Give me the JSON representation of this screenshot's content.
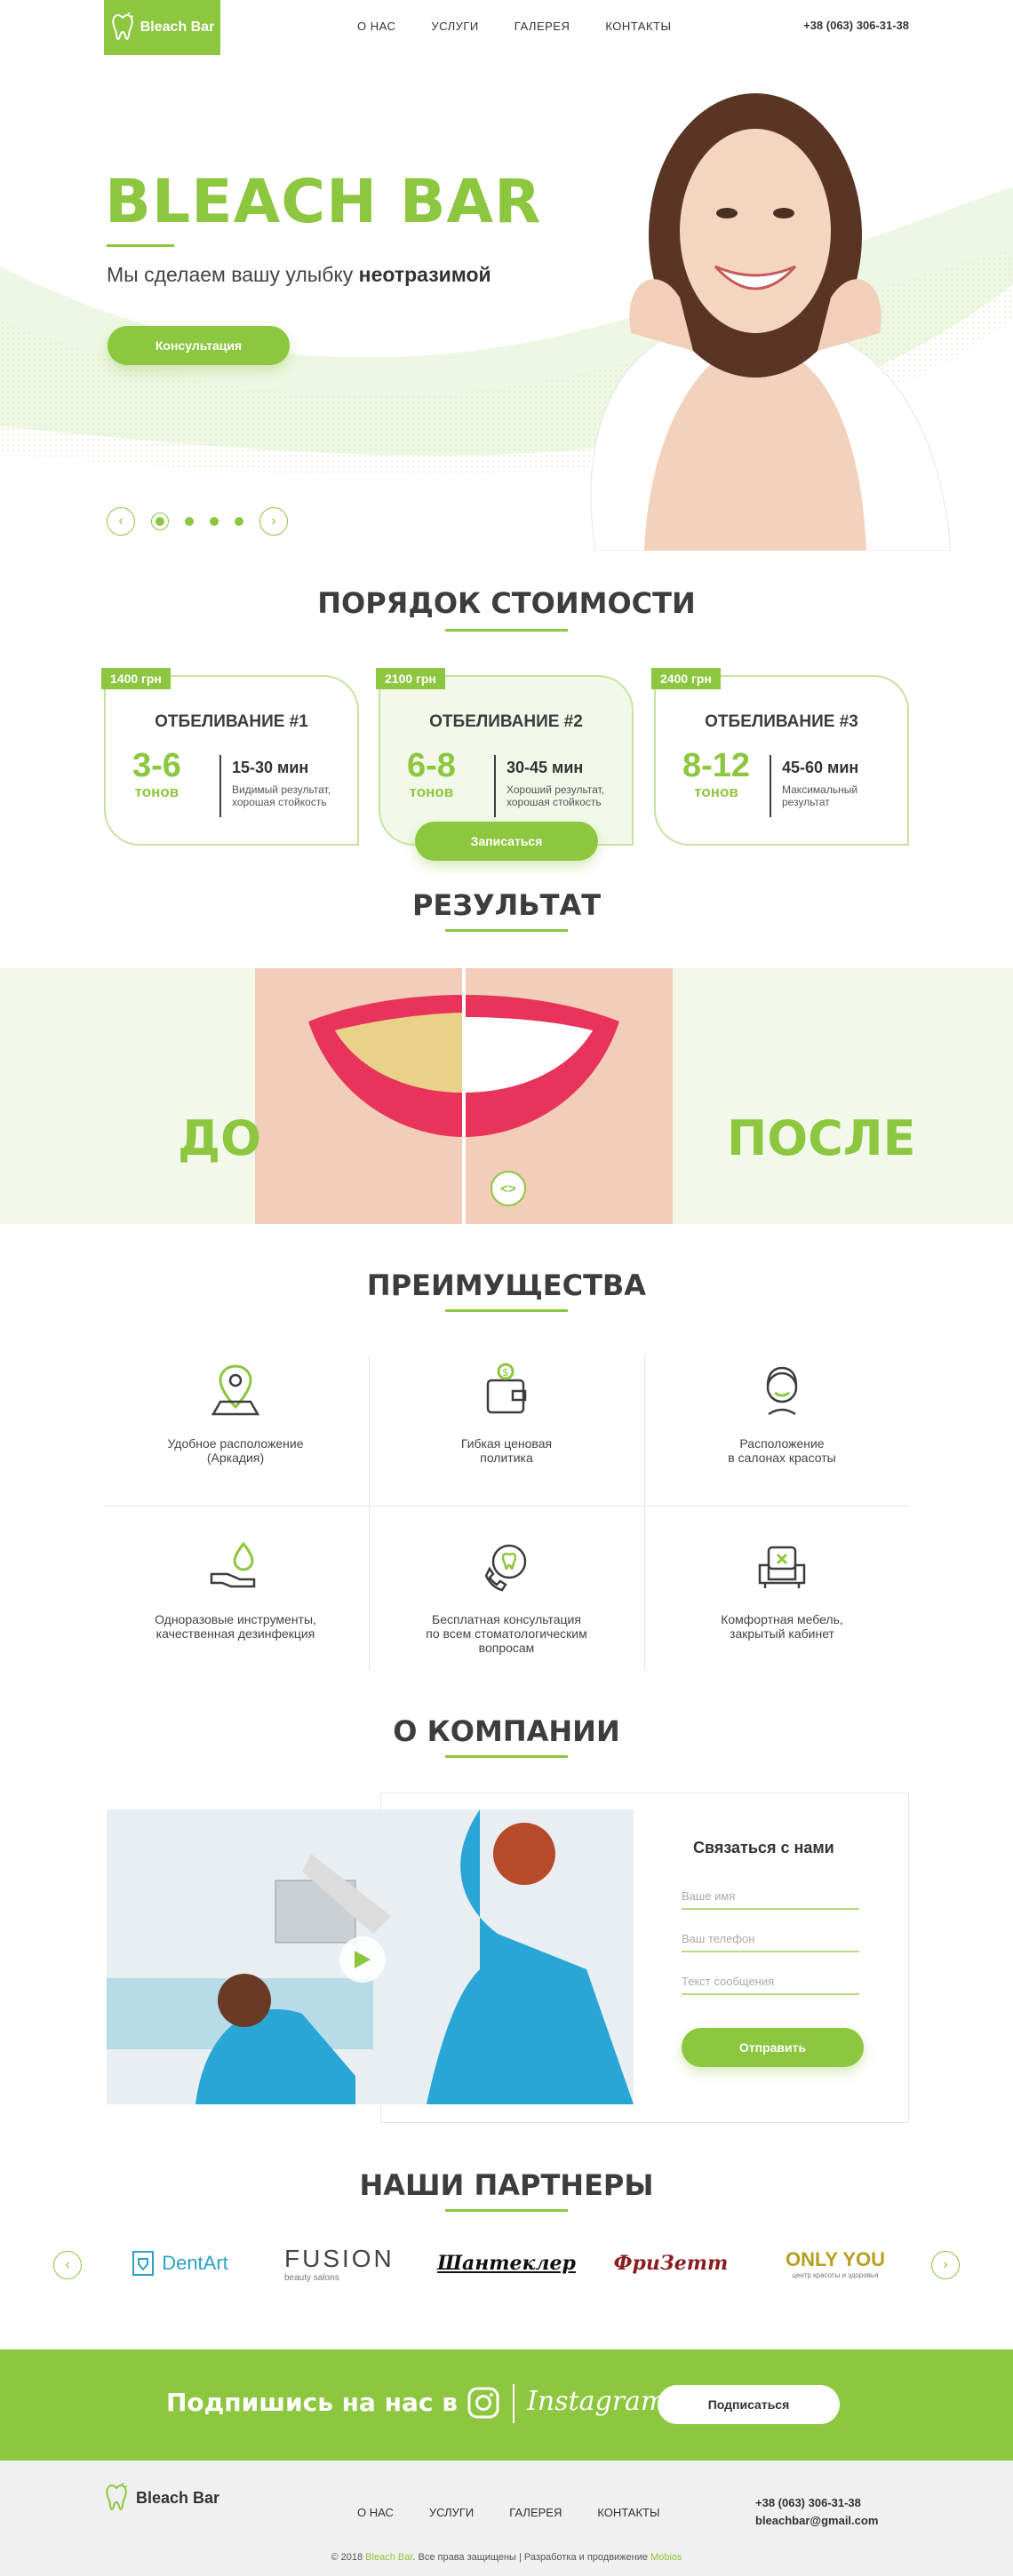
{
  "header": {
    "logo_text": "Bleach Bar",
    "nav": [
      "О НАС",
      "УСЛУГИ",
      "ГАЛЕРЕЯ",
      "КОНТАКТЫ"
    ],
    "phone": "+38 (063) 306-31-38"
  },
  "hero": {
    "title": "BLEACH BAR",
    "subtitle_plain": "Мы сделаем вашу улыбку ",
    "subtitle_bold": "неотразимой",
    "button": "Консультация"
  },
  "pricing": {
    "title": "ПОРЯДОК СТОИМОСТИ",
    "cards": [
      {
        "price": "1400 грн",
        "name": "ОТБЕЛИВАНИЕ #1",
        "tones": "3-6",
        "tones_unit": "тонов",
        "time": "15-30 мин",
        "desc1": "Видимый результат,",
        "desc2": "хорошая стойкость"
      },
      {
        "price": "2100 грн",
        "name": "ОТБЕЛИВАНИЕ #2",
        "tones": "6-8",
        "tones_unit": "тонов",
        "time": "30-45 мин",
        "desc1": "Хороший результат,",
        "desc2": "хорошая стойкость"
      },
      {
        "price": "2400 грн",
        "name": "ОТБЕЛИВАНИЕ #3",
        "tones": "8-12",
        "tones_unit": "тонов",
        "time": "45-60 мин",
        "desc1": "Максимальный",
        "desc2": "результат"
      }
    ],
    "button": "Записаться"
  },
  "result": {
    "title": "РЕЗУЛЬТАТ",
    "before": "ДО",
    "after": "ПОСЛЕ",
    "handle": "<>"
  },
  "advantages": {
    "title": "ПРЕИМУЩЕСТВА",
    "items": [
      {
        "icon": "map-pin-icon",
        "text": "Удобное расположение\n(Аркадия)"
      },
      {
        "icon": "wallet-icon",
        "text": "Гибкая ценовая\nполитика"
      },
      {
        "icon": "woman-icon",
        "text": "Расположение\nв салонах красоты"
      },
      {
        "icon": "hand-drop-icon",
        "text": "Одноразовые инструменты,\nкачественная дезинфекция"
      },
      {
        "icon": "phone-tooth-icon",
        "text": "Бесплатная консультация\nпо всем стоматологическим\nвопросам"
      },
      {
        "icon": "armchair-icon",
        "text": "Комфортная мебель,\nзакрытый кабинет"
      }
    ]
  },
  "about": {
    "title": "О КОМПАНИИ",
    "form_title": "Связаться с нами",
    "placeholders": {
      "name": "Ваше имя",
      "phone": "Ваш телефон",
      "message": "Текст сообщения"
    },
    "send": "Отправить"
  },
  "partners": {
    "title": "НАШИ ПАРТНЕРЫ",
    "logos": [
      "DentArt",
      "FUSION",
      "Шантеклер",
      "ФриЗетт",
      "ONLY YOU"
    ],
    "fusion_sub": "beauty salons",
    "onlyyou_sub": "центр красоты и здоровья"
  },
  "subscribe": {
    "text": "Подпишись на нас в",
    "insta": "Instagram",
    "button": "Подписаться"
  },
  "footer": {
    "logo_text": "Bleach Bar",
    "nav": [
      "О НАС",
      "УСЛУГИ",
      "ГАЛЕРЕЯ",
      "КОНТАКТЫ"
    ],
    "phone": "+38 (063) 306-31-38",
    "email": "bleachbar@gmail.com",
    "copy1": "© 2018 ",
    "copy_brand": "Bleach Bar",
    "copy2": ". Все права защищены | Разработка и продвижение ",
    "copy_dev": "Mobios"
  },
  "colors": {
    "accent": "#8dc63f",
    "light": "#f2f9ea",
    "text": "#3d3d3d"
  }
}
